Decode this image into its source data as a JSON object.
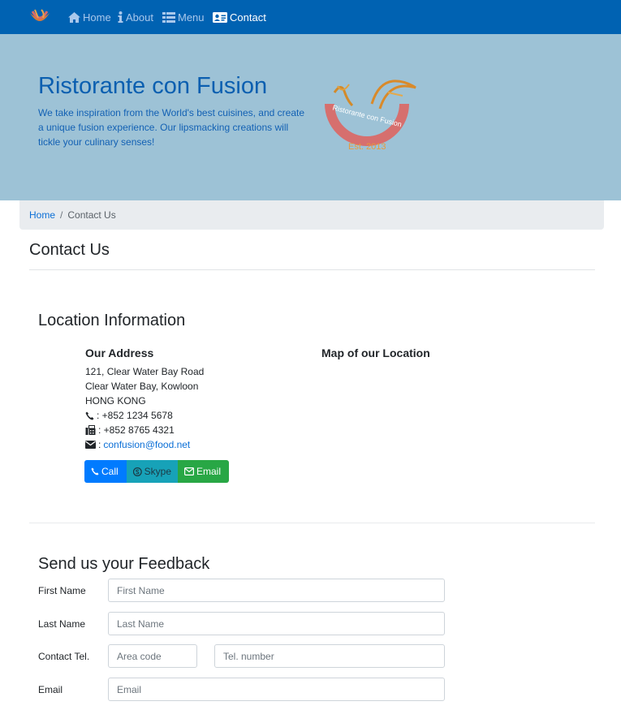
{
  "nav": {
    "items": [
      {
        "label": "Home",
        "icon": "home-icon"
      },
      {
        "label": "About",
        "icon": "info-icon"
      },
      {
        "label": "Menu",
        "icon": "list-icon"
      },
      {
        "label": "Contact",
        "icon": "address-card-icon"
      }
    ],
    "active": "Contact"
  },
  "jumbotron": {
    "title": "Ristorante con Fusion",
    "text": "We take inspiration from the World's best cuisines, and create a unique fusion experience. Our lipsmacking creations will tickle your culinary senses!",
    "logo_text": "Ristorante con Fusion",
    "logo_est": "Est. 2013"
  },
  "breadcrumb": {
    "home": "Home",
    "current": "Contact Us"
  },
  "page_title": "Contact Us",
  "location": {
    "title": "Location Information",
    "address_title": "Our Address",
    "address_lines": [
      "121, Clear Water Bay Road",
      "Clear Water Bay, Kowloon",
      "HONG KONG"
    ],
    "phone": ": +852 1234 5678",
    "fax": ": +852 8765 4321",
    "email_prefix": ":",
    "email": "confusion@food.net",
    "map_title": "Map of our Location",
    "buttons": {
      "call": "Call",
      "skype": "Skype",
      "email": "Email"
    }
  },
  "feedback": {
    "title": "Send us your Feedback",
    "first_name_label": "First Name",
    "first_name_placeholder": "First Name",
    "last_name_label": "Last Name",
    "last_name_placeholder": "Last Name",
    "tel_label": "Contact Tel.",
    "area_code_placeholder": "Area code",
    "tel_number_placeholder": "Tel. number",
    "email_label": "Email",
    "email_placeholder": "Email"
  },
  "colors": {
    "navbar": "#0062b2",
    "jumbotron": "#9dc2d6",
    "link": "#0b6fd6",
    "btn_call": "#007bff",
    "btn_skype": "#17a2b8",
    "btn_email": "#28a745"
  }
}
